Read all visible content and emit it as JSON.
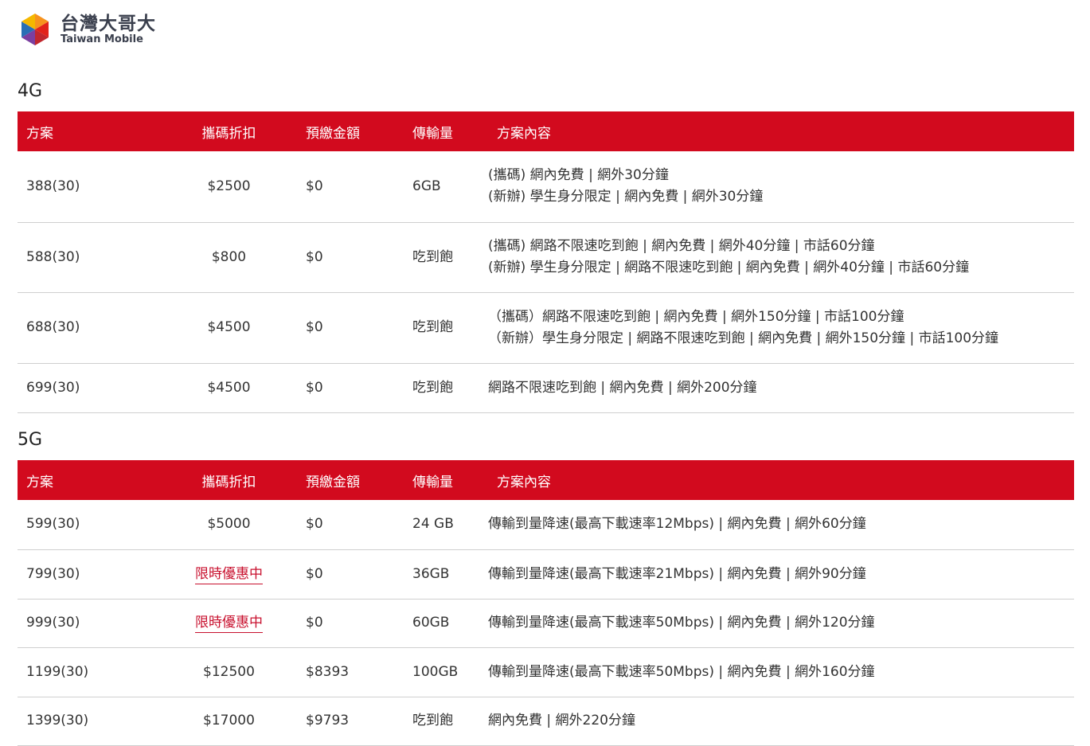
{
  "brand": {
    "name_zh": "台灣大哥大",
    "name_en": "Taiwan Mobile",
    "colors": [
      "#e2231a",
      "#f39c12",
      "#7b3fa0",
      "#2a6fb5"
    ]
  },
  "headers": {
    "plan": "方案",
    "discount": "攜碼折扣",
    "prepay": "預繳金額",
    "data": "傳輸量",
    "content": "方案內容"
  },
  "sections": [
    {
      "title": "4G",
      "rows": [
        {
          "plan": "388(30)",
          "discount": "$2500",
          "prepay": "$0",
          "data": "6GB",
          "content": [
            "(攜碼) 網內免費 | 網外30分鐘",
            "(新辦) 學生身分限定 | 網內免費 | 網外30分鐘"
          ]
        },
        {
          "plan": "588(30)",
          "discount": "$800",
          "prepay": "$0",
          "data": "吃到飽",
          "content": [
            "(攜碼) 網路不限速吃到飽 | 網內免費 | 網外40分鐘 | 市話60分鐘",
            "(新辦) 學生身分限定 | 網路不限速吃到飽 | 網內免費 | 網外40分鐘 | 市話60分鐘"
          ]
        },
        {
          "plan": "688(30)",
          "discount": "$4500",
          "prepay": "$0",
          "data": "吃到飽",
          "content": [
            "（攜碼）網路不限速吃到飽 | 網內免費 | 網外150分鐘 | 市話100分鐘",
            "（新辦）學生身分限定 | 網路不限速吃到飽 | 網內免費 | 網外150分鐘 | 市話100分鐘"
          ]
        },
        {
          "plan": "699(30)",
          "discount": "$4500",
          "prepay": "$0",
          "data": "吃到飽",
          "content": [
            "網路不限速吃到飽 | 網內免費 | 網外200分鐘"
          ]
        }
      ]
    },
    {
      "title": "5G",
      "rows": [
        {
          "plan": "599(30)",
          "discount": "$5000",
          "prepay": "$0",
          "data": "24 GB",
          "content": [
            "傳輸到量降速(最高下載速率12Mbps) | 網內免費 | 網外60分鐘"
          ]
        },
        {
          "plan": "799(30)",
          "discount": "限時優惠中",
          "promo": true,
          "prepay": "$0",
          "data": "36GB",
          "content": [
            "傳輸到量降速(最高下載速率21Mbps) | 網內免費 | 網外90分鐘"
          ]
        },
        {
          "plan": "999(30)",
          "discount": "限時優惠中",
          "promo": true,
          "prepay": "$0",
          "data": "60GB",
          "content": [
            "傳輸到量降速(最高下載速率50Mbps) | 網內免費 | 網外120分鐘"
          ]
        },
        {
          "plan": "1199(30)",
          "discount": "$12500",
          "prepay": "$8393",
          "data": "100GB",
          "content": [
            "傳輸到量降速(最高下載速率50Mbps) | 網內免費 | 網外160分鐘"
          ]
        },
        {
          "plan": "1399(30)",
          "discount": "$17000",
          "prepay": "$9793",
          "data": "吃到飽",
          "content": [
            "網內免費 | 網外220分鐘"
          ]
        }
      ]
    }
  ]
}
